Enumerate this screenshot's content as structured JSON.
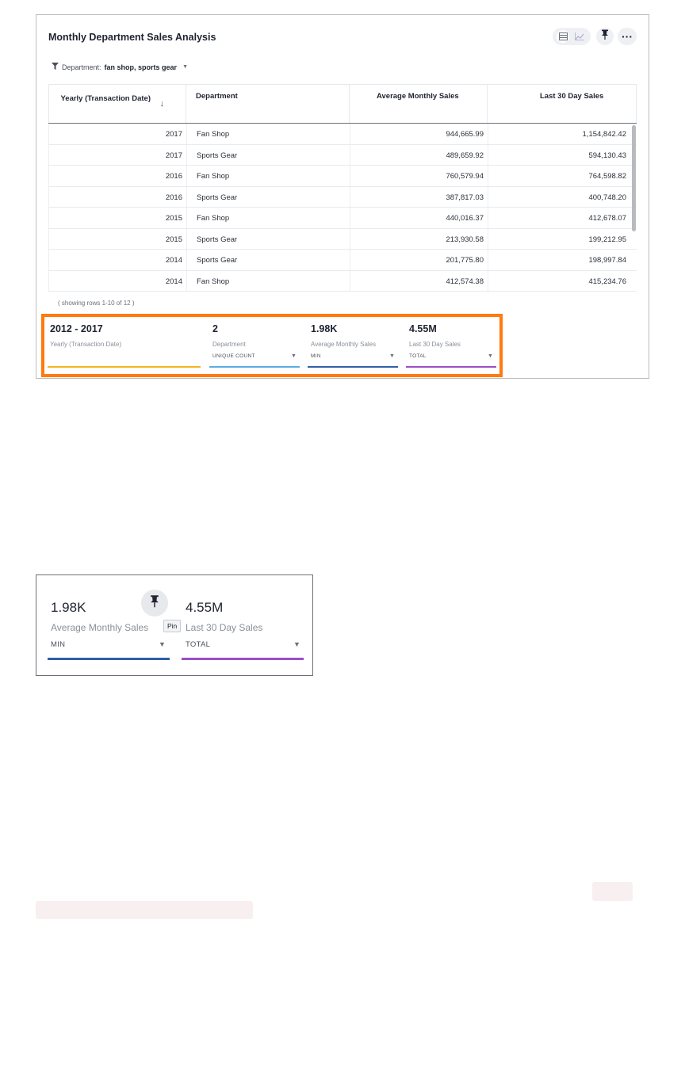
{
  "card": {
    "title": "Monthly Department Sales Analysis",
    "filter": {
      "label": "Department:",
      "value": "fan shop, sports gear"
    },
    "columns": {
      "year": "Yearly (Transaction Date)",
      "department": "Department",
      "avg_monthly": "Average Monthly Sales",
      "last_30": "Last 30 Day Sales"
    },
    "rows": [
      {
        "year": "2017",
        "department": "Fan Shop",
        "avg_monthly": "944,665.99",
        "last_30": "1,154,842.42"
      },
      {
        "year": "2017",
        "department": "Sports Gear",
        "avg_monthly": "489,659.92",
        "last_30": "594,130.43"
      },
      {
        "year": "2016",
        "department": "Fan Shop",
        "avg_monthly": "760,579.94",
        "last_30": "764,598.82"
      },
      {
        "year": "2016",
        "department": "Sports Gear",
        "avg_monthly": "387,817.03",
        "last_30": "400,748.20"
      },
      {
        "year": "2015",
        "department": "Fan Shop",
        "avg_monthly": "440,016.37",
        "last_30": "412,678.07"
      },
      {
        "year": "2015",
        "department": "Sports Gear",
        "avg_monthly": "213,930.58",
        "last_30": "199,212.95"
      },
      {
        "year": "2014",
        "department": "Sports Gear",
        "avg_monthly": "201,775.80",
        "last_30": "198,997.84"
      },
      {
        "year": "2014",
        "department": "Fan Shop",
        "avg_monthly": "412,574.38",
        "last_30": "415,234.76"
      }
    ],
    "row_count": "( showing rows 1-10 of 12 )",
    "summary": {
      "year": {
        "value": "2012  -  2017",
        "label": "Yearly (Transaction Date)",
        "color": "#f5b51f"
      },
      "department": {
        "value": "2",
        "label": "Department",
        "aggregation": "UNIQUE COUNT",
        "color": "#5aaee3"
      },
      "avg_monthly": {
        "value": "1.98K",
        "label": "Average Monthly Sales",
        "aggregation": "MIN",
        "color": "#2e5fa7"
      },
      "last_30": {
        "value": "4.55M",
        "label": "Last 30 Day Sales",
        "aggregation": "TOTAL",
        "color": "#9b4fc9"
      }
    },
    "highlight_color": "#ff7a10"
  },
  "zoom": {
    "avg_monthly": {
      "value": "1.98K",
      "label": "Average Monthly Sales",
      "aggregation": "MIN"
    },
    "last_30": {
      "value": "4.55M",
      "label": "Last 30 Day Sales",
      "aggregation": "TOTAL"
    },
    "pin_tooltip": "Pin"
  },
  "icons": [
    "filter-icon",
    "table-view-icon",
    "chart-view-icon",
    "pin-icon",
    "more-icon",
    "sort-down-icon",
    "caret-down-icon"
  ]
}
